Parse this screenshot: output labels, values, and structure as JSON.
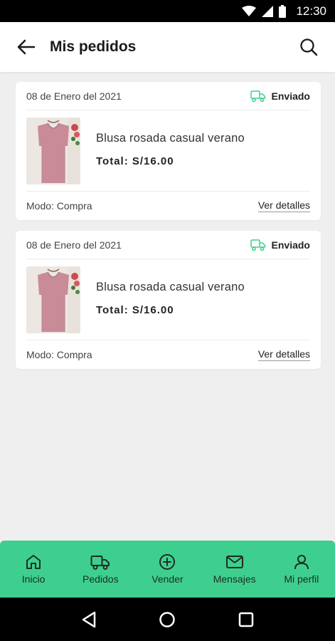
{
  "status_bar": {
    "time": "12:30"
  },
  "app_bar": {
    "title": "Mis pedidos"
  },
  "orders": [
    {
      "date": "08 de Enero del 2021",
      "status": "Enviado",
      "product_name": "Blusa rosada casual verano",
      "total": "Total: S/16.00",
      "mode": "Modo: Compra",
      "details_link": "Ver detalles"
    },
    {
      "date": "08 de Enero del 2021",
      "status": "Enviado",
      "product_name": "Blusa rosada casual verano",
      "total": "Total: S/16.00",
      "mode": "Modo: Compra",
      "details_link": "Ver detalles"
    }
  ],
  "bottom_nav": {
    "items": [
      {
        "label": "Inicio",
        "icon": "home-icon"
      },
      {
        "label": "Pedidos",
        "icon": "truck-icon"
      },
      {
        "label": "Vender",
        "icon": "plus-circle-icon"
      },
      {
        "label": "Mensajes",
        "icon": "mail-icon"
      },
      {
        "label": "Mi perfil",
        "icon": "user-icon"
      }
    ]
  },
  "colors": {
    "accent": "#3ecf8e",
    "background": "#efefef"
  }
}
